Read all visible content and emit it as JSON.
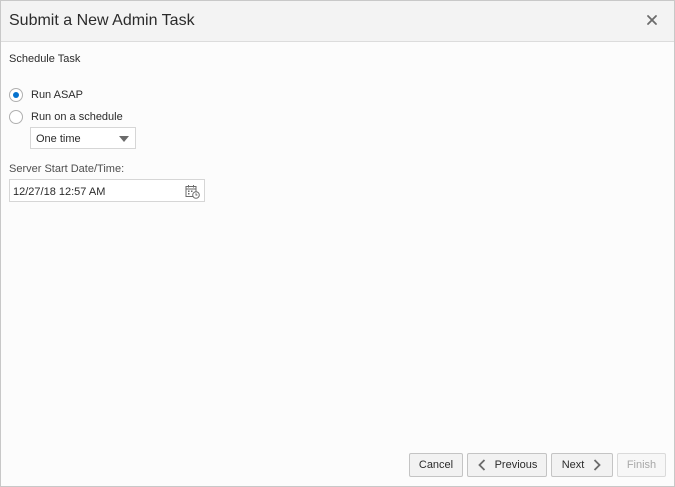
{
  "dialog": {
    "title": "Submit a New Admin Task",
    "close_icon": "close-icon"
  },
  "schedule": {
    "section_title": "Schedule Task",
    "options": [
      {
        "label": "Run ASAP",
        "selected": true
      },
      {
        "label": "Run on a schedule",
        "selected": false
      }
    ],
    "frequency": {
      "selected": "One time"
    }
  },
  "start": {
    "label": "Server Start Date/Time:",
    "value": "12/27/18 12:57 AM",
    "icon": "calendar-clock-icon"
  },
  "footer": {
    "cancel_label": "Cancel",
    "previous_label": "Previous",
    "next_label": "Next",
    "finish_label": "Finish"
  },
  "colors": {
    "accent": "#0572ce",
    "header_bg": "#f3f3f3"
  }
}
